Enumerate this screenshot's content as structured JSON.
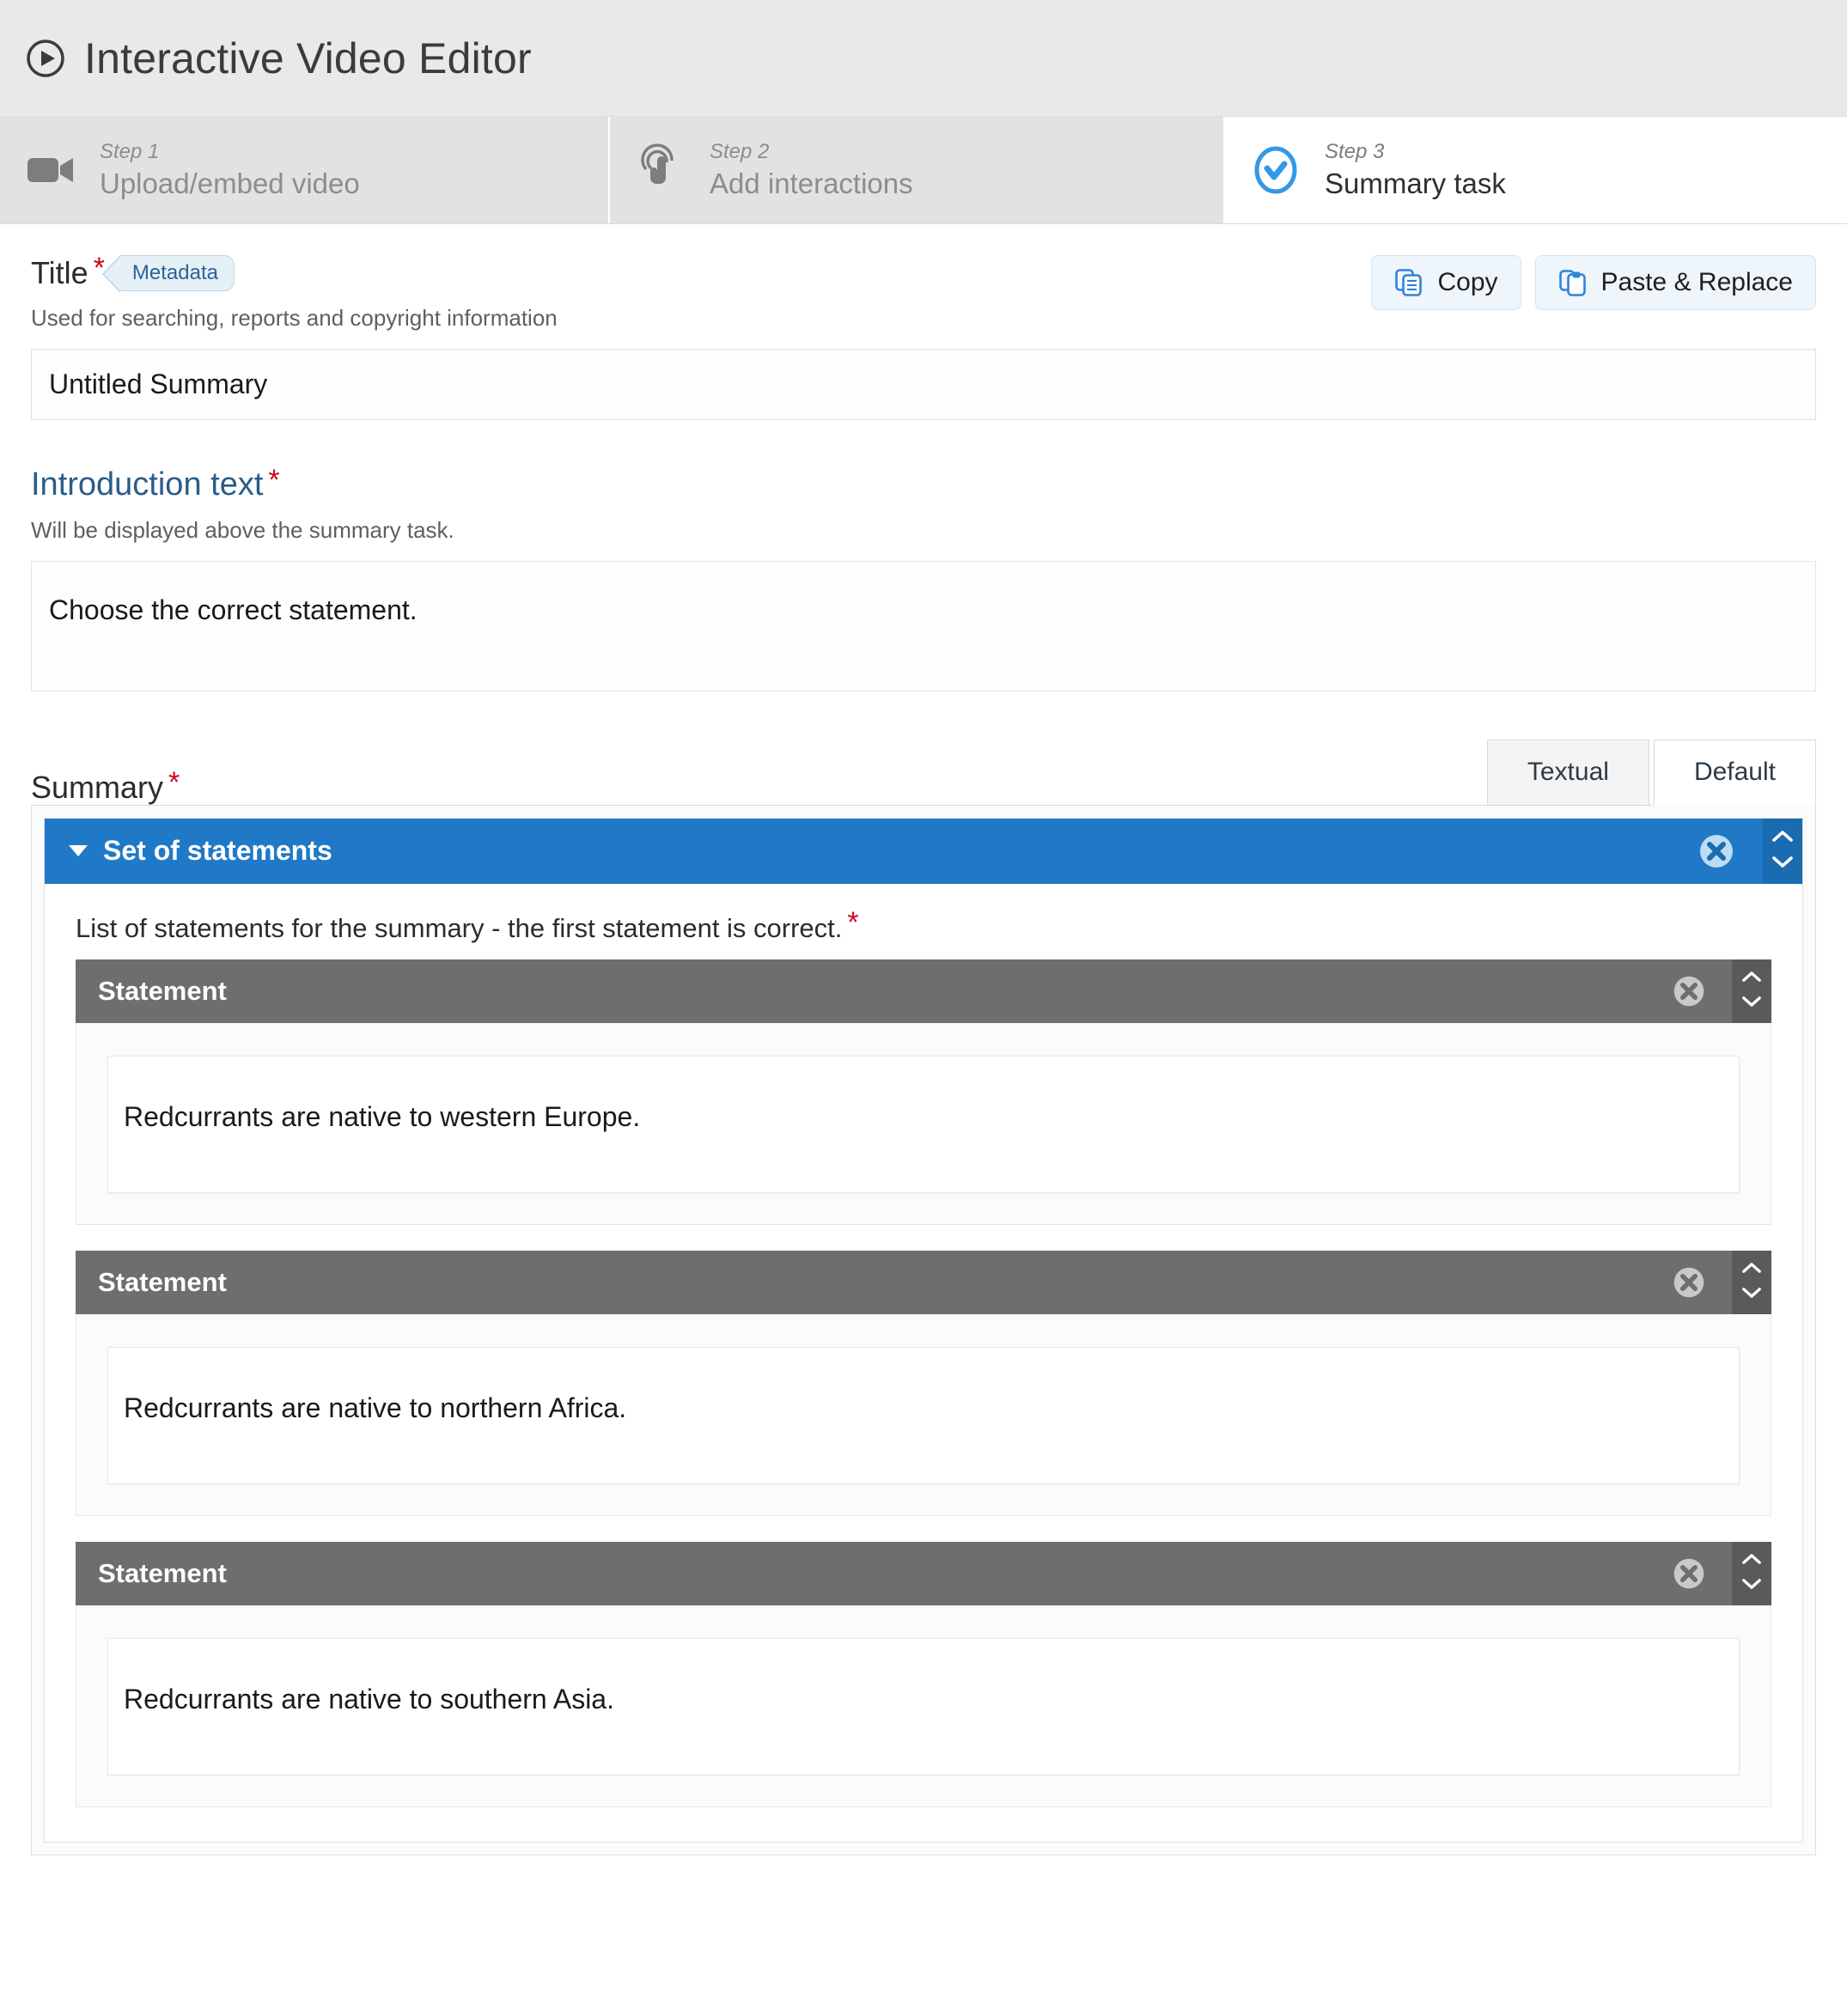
{
  "app": {
    "title": "Interactive Video Editor",
    "icon": "play-circle-icon"
  },
  "steps": [
    {
      "num": "Step 1",
      "label": "Upload/embed video",
      "icon": "video-camera-icon",
      "active": false
    },
    {
      "num": "Step 2",
      "label": "Add interactions",
      "icon": "touch-pointer-icon",
      "active": false
    },
    {
      "num": "Step 3",
      "label": "Summary task",
      "icon": "check-circle-icon",
      "active": true
    }
  ],
  "title_field": {
    "label": "Title",
    "required_marker": "*",
    "badge": "Metadata",
    "description": "Used for searching, reports and copyright information",
    "value": "Untitled Summary",
    "placeholder": ""
  },
  "toolbar": {
    "copy_label": "Copy",
    "paste_label": "Paste & Replace",
    "copy_icon": "copy-icon",
    "paste_icon": "clipboard-icon"
  },
  "intro_field": {
    "label": "Introduction text",
    "required_marker": "*",
    "description": "Will be displayed above the summary task.",
    "value": "Choose the correct statement."
  },
  "summary": {
    "label": "Summary",
    "required_marker": "*",
    "tabs": [
      {
        "label": "Textual",
        "active": false
      },
      {
        "label": "Default",
        "active": true
      }
    ],
    "group": {
      "title": "Set of statements",
      "collapse_icon": "caret-down-icon",
      "delete_icon": "delete-circle-icon",
      "move_up_icon": "chevron-up-icon",
      "move_down_icon": "chevron-down-icon",
      "list_label": "List of statements for the summary - the first statement is correct.",
      "list_required_marker": "*",
      "statements": [
        {
          "header": "Statement",
          "text": "Redcurrants are native to western Europe."
        },
        {
          "header": "Statement",
          "text": "Redcurrants are native to northern Africa."
        },
        {
          "header": "Statement",
          "text": "Redcurrants are native to southern Asia."
        }
      ]
    }
  },
  "colors": {
    "accent_blue": "#2079c6",
    "accent_blue_dark": "#1a6bb0",
    "statement_grey": "#6e6e6e",
    "required_red": "#d0021b",
    "link_blue": "#2a5c8a",
    "step_active_icon": "#3399e6"
  }
}
